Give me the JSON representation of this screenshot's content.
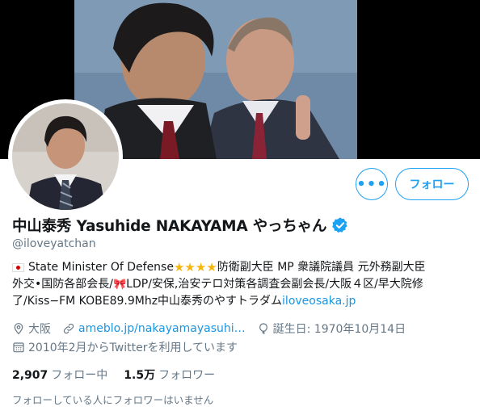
{
  "profile": {
    "name": "中山泰秀 Yasuhide NAKAYAMA やっちゃん",
    "handle": "@iloveyatchan",
    "bio": {
      "line1_text": "State Minister Of Defense",
      "line1_stars": "★★★★",
      "line1_rest": "防衛副大臣 MP 衆議院議員 元外務副大臣",
      "line2_text": "外交•国防各部会長/",
      "line2_ribbon": "🎀",
      "line2_rest": " LDP/安保,治安テロ対策各調査会副会長/大阪４区/早大院修",
      "line3_text": "了/Kiss−FM KOBE89.9Mhz中山泰秀のやすトラダム",
      "line3_link": "iloveosaka.jp"
    },
    "location": "大阪",
    "website": "ameblo.jp/nakayamayasuhi…",
    "birthday": "誕生日: 1970年10月14日",
    "joined": "2010年2月からTwitterを利用しています",
    "following_count": "2,907",
    "following_label": "フォロー中",
    "followers_count": "1.5万",
    "followers_label": "フォロワー",
    "mutual_note": "フォローしている人にフォロワーはいません"
  },
  "actions": {
    "more_label": "•••",
    "follow_label": "フォロー"
  },
  "colors": {
    "accent": "#1da1f2",
    "link": "#1b95e0",
    "secondary_text": "#657786",
    "star": "#f5b50a"
  }
}
